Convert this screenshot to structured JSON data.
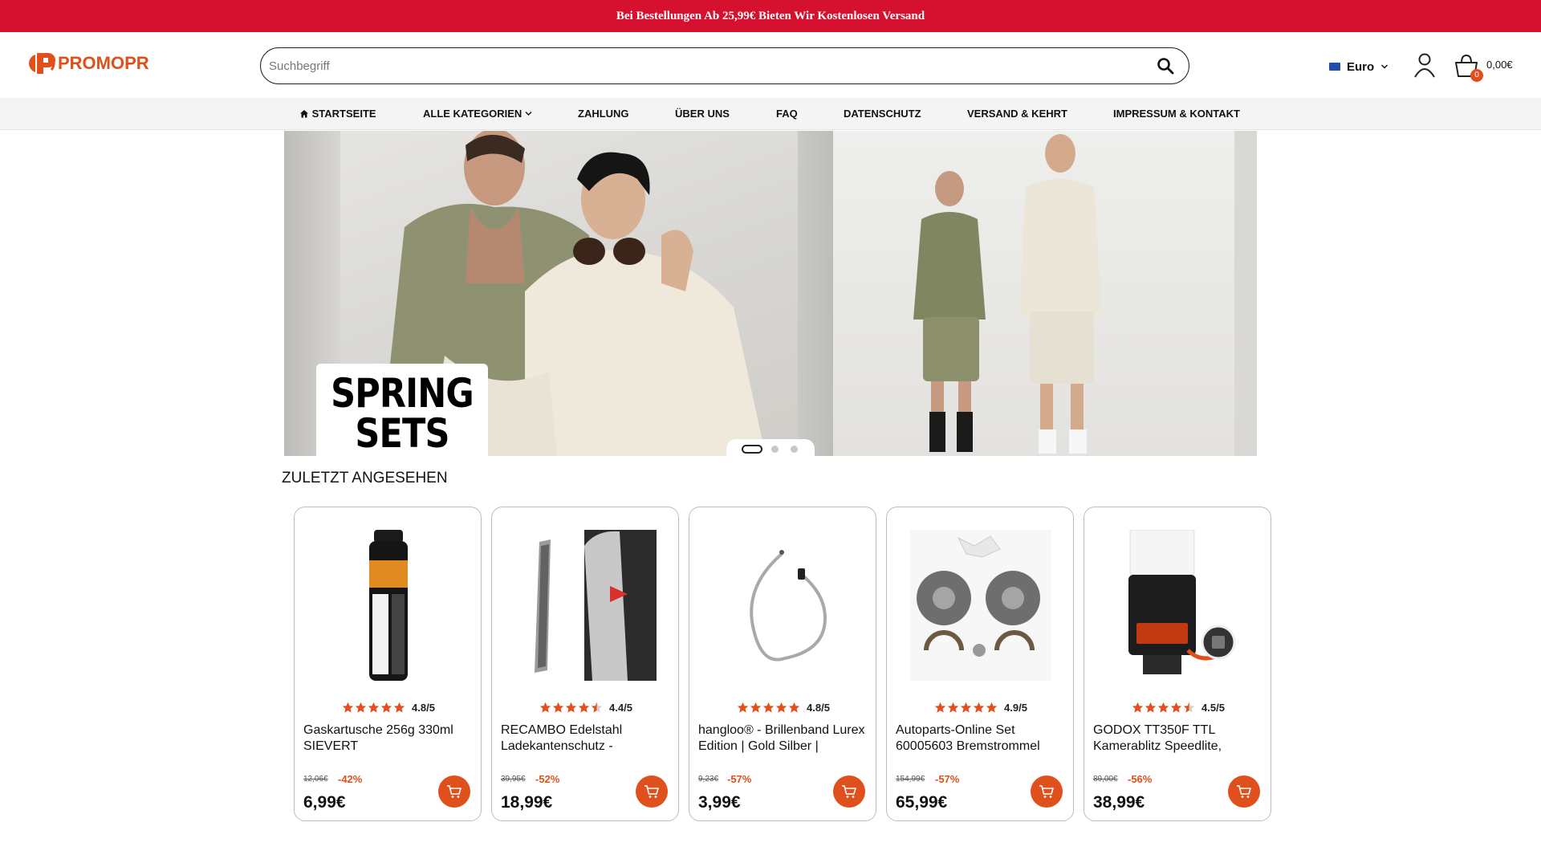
{
  "announcement": "Bei Bestellungen Ab 25,99€ Bieten Wir Kostenlosen Versand",
  "brand": {
    "name": "PROMOPR",
    "accent": "#e0501c",
    "banner_color": "#d5112f"
  },
  "header": {
    "search_placeholder": "Suchbegriff",
    "currency": "Euro",
    "cart_count": "0",
    "cart_total": "0,00€"
  },
  "nav": {
    "items": [
      {
        "label": "STARTSEITE",
        "icon": "home-icon"
      },
      {
        "label": "ALLE KATEGORIEN",
        "icon": "chevron-down-icon"
      },
      {
        "label": "ZAHLUNG"
      },
      {
        "label": "ÜBER UNS"
      },
      {
        "label": "FAQ"
      },
      {
        "label": "DATENSCHUTZ"
      },
      {
        "label": "VERSAND & KEHRT"
      },
      {
        "label": "IMPRESSUM & KONTAKT"
      }
    ]
  },
  "hero": {
    "promo_lines": [
      "SPRING",
      "SETS"
    ],
    "slide_count": 3,
    "active_slide": 1
  },
  "recent": {
    "title": "ZULETZT ANGESEHEN",
    "products": [
      {
        "name": "Gaskartusche 256g 330ml SIEVERT",
        "rating": "4.8/5",
        "stars": 5,
        "old_price": "12,06€",
        "discount": "-42%",
        "price": "6,99€",
        "image": "gas-cartridge"
      },
      {
        "name": "RECAMBO Edelstahl Ladekantenschutz -",
        "rating": "4.4/5",
        "stars": 4.5,
        "old_price": "39,95€",
        "discount": "-52%",
        "price": "18,99€",
        "image": "bumper-protector"
      },
      {
        "name": "hangloo® - Brillenband Lurex Edition | Gold Silber |",
        "rating": "4.8/5",
        "stars": 5,
        "old_price": "9,23€",
        "discount": "-57%",
        "price": "3,99€",
        "image": "glasses-strap"
      },
      {
        "name": "Autoparts-Online Set 60005603 Bremstrommel",
        "rating": "4.9/5",
        "stars": 5,
        "old_price": "154,99€",
        "discount": "-57%",
        "price": "65,99€",
        "image": "brake-drum-set"
      },
      {
        "name": "GODOX TT350F TTL Kamerablitz Speedlite,",
        "rating": "4.5/5",
        "stars": 4.5,
        "old_price": "89,00€",
        "discount": "-56%",
        "price": "38,99€",
        "image": "camera-flash"
      }
    ]
  }
}
